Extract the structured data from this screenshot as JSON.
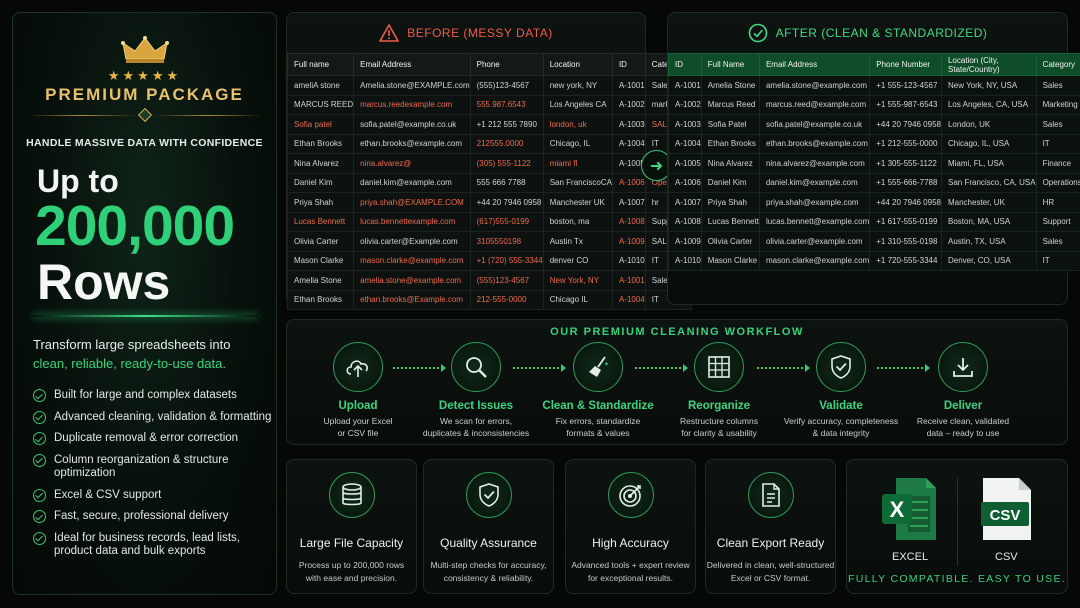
{
  "left": {
    "package": "PREMIUM PACKAGE",
    "tagline": "HANDLE MASSIVE DATA WITH CONFIDENCE",
    "upto": "Up to",
    "number": "200,000",
    "rows": "Rows",
    "transform_line1": "Transform large spreadsheets into",
    "transform_line2": "clean, reliable, ready-to-use data.",
    "features": [
      "Built for large and complex datasets",
      "Advanced cleaning, validation & formatting",
      "Duplicate removal & error correction",
      "Column reorganization & structure optimization",
      "Excel & CSV support",
      "Fast, secure, professional delivery",
      "Ideal for business records, lead lists, product data and bulk exports"
    ]
  },
  "before": {
    "title": "BEFORE (MESSY DATA)",
    "headers": [
      "Full name",
      "Email Address",
      "Phone",
      "Location",
      "ID",
      "Category"
    ],
    "rows": [
      [
        "ameliA stone",
        "Amelia.stone@EXAMPLE.com",
        "(555)123-4567",
        "new york, NY",
        "A-1001",
        "Sales"
      ],
      [
        "MARCUS REED",
        "marcus.reedexample.com",
        "555.987.6543",
        "Los Angeles CA",
        "A-1002",
        "marketing"
      ],
      [
        "Sofia  patel",
        "sofia.patel@example.co.uk",
        "+1 212 555 7890",
        "london, uk",
        "A-1003",
        "SALES"
      ],
      [
        "Ethan Brooks",
        "ethan.brooks@example.com",
        "212555.0000",
        "Chicago, IL",
        "A-1004",
        "IT"
      ],
      [
        "Nina Alvarez",
        "nina.alvarez@",
        "(305) 555-1122",
        "miami fl",
        "A-1005",
        "finance"
      ],
      [
        "Daniel Kim",
        "daniel.kim@example.com",
        "555 666 7788",
        "San FranciscoCA",
        "A-1006",
        "Operations"
      ],
      [
        "Priya Shah",
        "priya.shah@EXAMPLE.COM",
        "+44 20 7946 0958",
        "Manchester UK",
        "A-1007",
        "hr"
      ],
      [
        "Lucas Bennett",
        "lucas.bennettexample.com",
        "(617)555-0199",
        "boston, ma",
        "A-1008",
        "Support"
      ],
      [
        "Olivia Carter",
        "olivia.carter@Example.com",
        "3105550198",
        "Austin Tx",
        "A-1009",
        "SALES"
      ],
      [
        "Mason Clarke",
        "mason.clarke@example.com",
        "+1 (720) 555-3344",
        "denver  CO",
        "A-1010",
        "IT"
      ],
      [
        "Amelia Stone",
        "amelia.stone@example.com",
        "(555)123-4567",
        "New York, NY",
        "A-1001",
        "Sales"
      ],
      [
        "Ethan Brooks",
        "ethan.brooks@Example.com",
        "212-555-0000",
        "Chicago  IL",
        "A-1004",
        "IT"
      ]
    ]
  },
  "after": {
    "title": "AFTER (CLEAN & STANDARDIZED)",
    "headers": [
      "ID",
      "Full Name",
      "Email Address",
      "Phone Number",
      "Location (City, State/Country)",
      "Category"
    ],
    "rows": [
      [
        "A-1001",
        "Amelia Stone",
        "amelia.stone@example.com",
        "+1 555-123-4567",
        "New York, NY, USA",
        "Sales"
      ],
      [
        "A-1002",
        "Marcus Reed",
        "marcus.reed@example.com",
        "+1 555-987-6543",
        "Los Angeles, CA, USA",
        "Marketing"
      ],
      [
        "A-1003",
        "Sofia Patel",
        "sofia.patel@example.co.uk",
        "+44 20 7946 0958",
        "London, UK",
        "Sales"
      ],
      [
        "A-1004",
        "Ethan Brooks",
        "ethan.brooks@example.com",
        "+1 212-555-0000",
        "Chicago, IL, USA",
        "IT"
      ],
      [
        "A-1005",
        "Nina Alvarez",
        "nina.alvarez@example.com",
        "+1 305-555-1122",
        "Miami, FL, USA",
        "Finance"
      ],
      [
        "A-1006",
        "Daniel Kim",
        "daniel.kim@example.com",
        "+1 555-666-7788",
        "San Francisco, CA, USA",
        "Operations"
      ],
      [
        "A-1007",
        "Priya Shah",
        "priya.shah@example.com",
        "+44 20 7946 0958",
        "Manchester, UK",
        "HR"
      ],
      [
        "A-1008",
        "Lucas Bennett",
        "lucas.bennett@example.com",
        "+1 617-555-0199",
        "Boston, MA, USA",
        "Support"
      ],
      [
        "A-1009",
        "Olivia Carter",
        "olivia.carter@example.com",
        "+1 310-555-0198",
        "Austin, TX, USA",
        "Sales"
      ],
      [
        "A-1010",
        "Mason Clarke",
        "mason.clarke@example.com",
        "+1 720-555-3344",
        "Denver, CO, USA",
        "IT"
      ]
    ]
  },
  "workflow": {
    "title": "OUR PREMIUM CLEANING WORKFLOW",
    "steps": [
      {
        "name": "Upload",
        "desc1": "Upload your Excel",
        "desc2": "or CSV file",
        "icon": "cloud-upload-icon"
      },
      {
        "name": "Detect Issues",
        "desc1": "We scan for errors,",
        "desc2": "duplicates & inconsistencies",
        "icon": "magnifier-icon"
      },
      {
        "name": "Clean & Standardize",
        "desc1": "Fix errors, standardize",
        "desc2": "formats & values",
        "icon": "broom-icon"
      },
      {
        "name": "Reorganize",
        "desc1": "Restructure columns",
        "desc2": "for clarity & usability",
        "icon": "grid-icon"
      },
      {
        "name": "Validate",
        "desc1": "Verify accuracy, completeness",
        "desc2": "& data integrity",
        "icon": "shield-check-icon"
      },
      {
        "name": "Deliver",
        "desc1": "Receive clean, validated",
        "desc2": "data – ready to use",
        "icon": "download-icon"
      }
    ]
  },
  "cards": [
    {
      "title": "Large File Capacity",
      "d1": "Process up to 200,000 rows",
      "d2": "with ease and precision.",
      "icon": "database-icon"
    },
    {
      "title": "Quality Assurance",
      "d1": "Multi-step checks for accuracy,",
      "d2": "consistency & reliability.",
      "icon": "shield-check-icon"
    },
    {
      "title": "High Accuracy",
      "d1": "Advanced tools + expert review",
      "d2": "for exceptional results.",
      "icon": "target-icon"
    },
    {
      "title": "Clean Export Ready",
      "d1": "Delivered in clean, well-structured",
      "d2": "Excel or CSV format.",
      "icon": "document-icon"
    }
  ],
  "formats": {
    "excel": "EXCEL",
    "csv": "CSV",
    "excel_letter": "X",
    "csv_letters": "CSV",
    "footer": "FULLY COMPATIBLE. EASY TO USE."
  },
  "colors": {
    "accent": "#2fd07a",
    "error": "#ef5a4a",
    "gold": "#e9c16d"
  }
}
